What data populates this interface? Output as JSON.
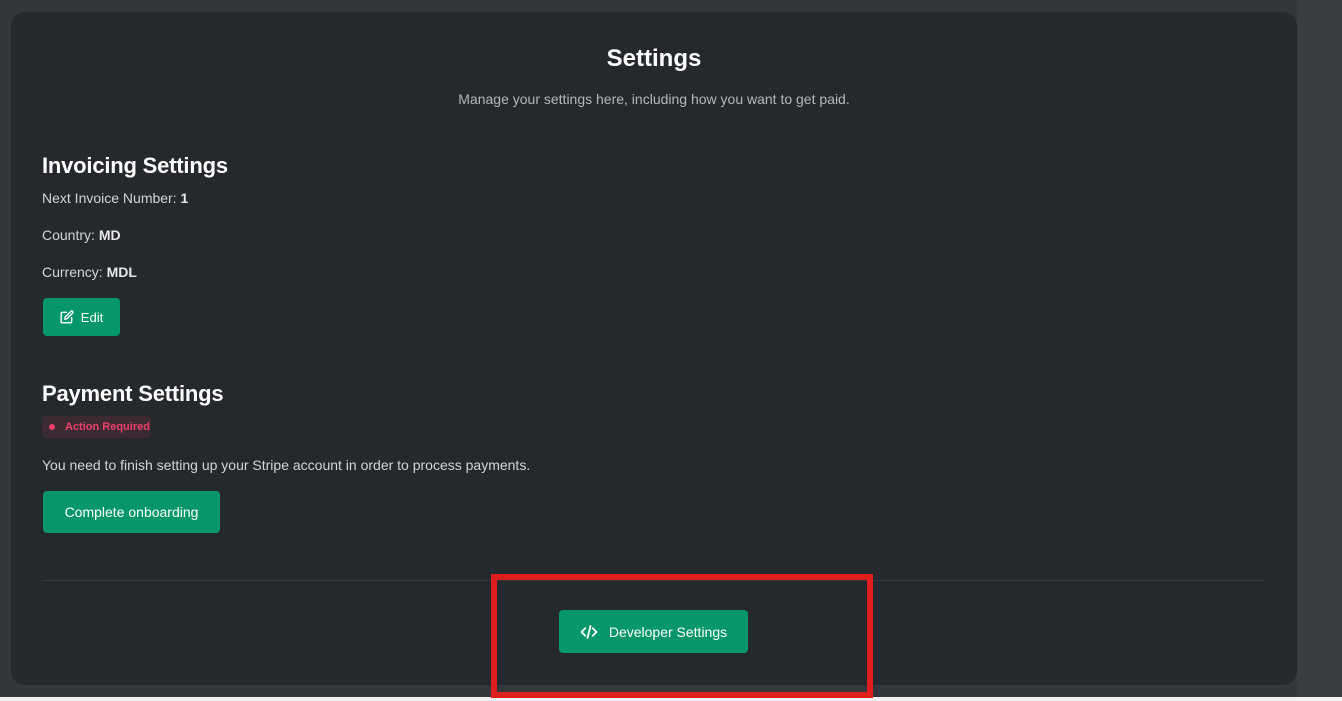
{
  "page": {
    "title": "Settings",
    "subtitle": "Manage your settings here, including how you want to get paid."
  },
  "invoicing": {
    "heading": "Invoicing Settings",
    "next_invoice_label": "Next Invoice Number:",
    "next_invoice_value": "1",
    "country_label": "Country:",
    "country_value": "MD",
    "currency_label": "Currency:",
    "currency_value": "MDL",
    "edit_label": "Edit"
  },
  "payment": {
    "heading": "Payment Settings",
    "badge": "Action Required",
    "message": "You need to finish setting up your Stripe account in order to process payments.",
    "onboarding_label": "Complete onboarding"
  },
  "developer": {
    "button_label": "Developer Settings"
  },
  "colors": {
    "accent": "#059669",
    "badge_text": "#f0406a",
    "highlight": "#e01e1e",
    "card_bg": "#25282c"
  },
  "icons": {
    "edit": "edit-icon",
    "badge_dot": "status-dot-icon",
    "developer": "code-icon"
  }
}
